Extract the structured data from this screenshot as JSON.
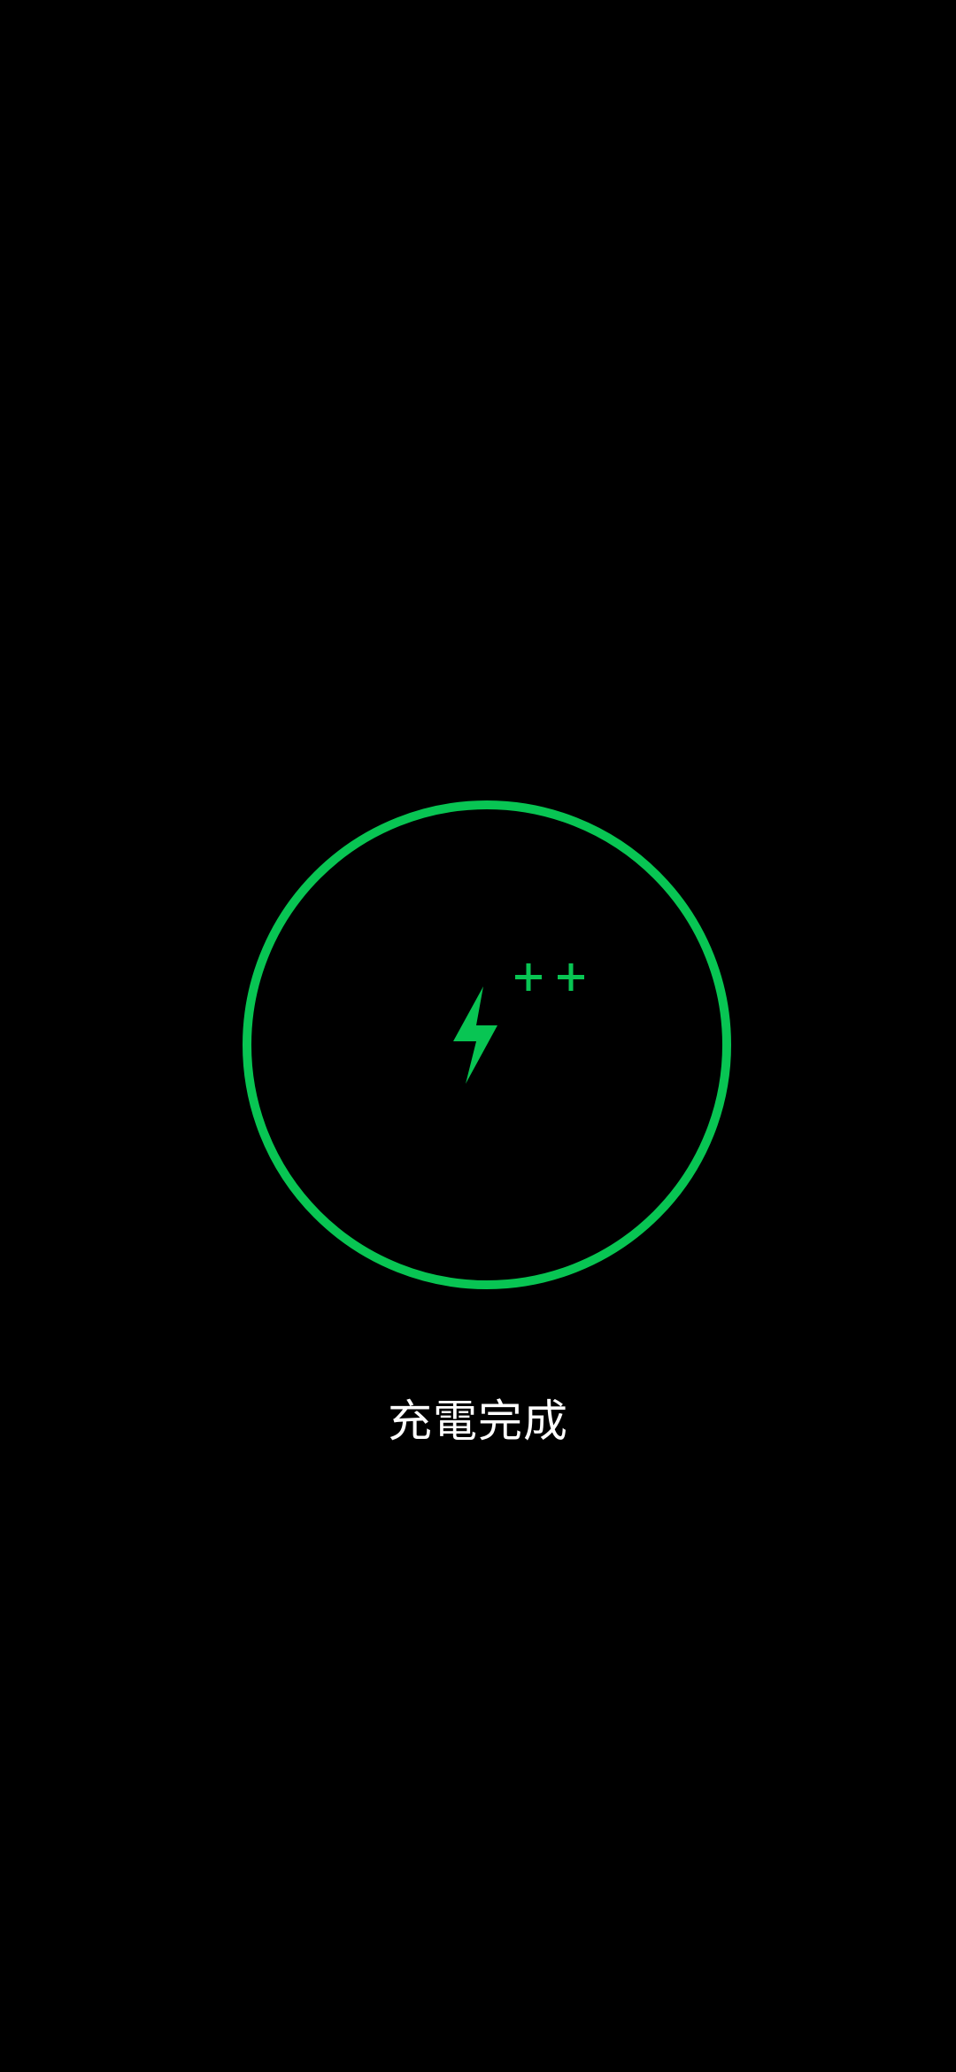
{
  "charging": {
    "status_text": "充電完成",
    "accent_color": "#08c553",
    "center_icon": "lightning-bolt-icon",
    "badge_icon": "double-plus-icon"
  }
}
